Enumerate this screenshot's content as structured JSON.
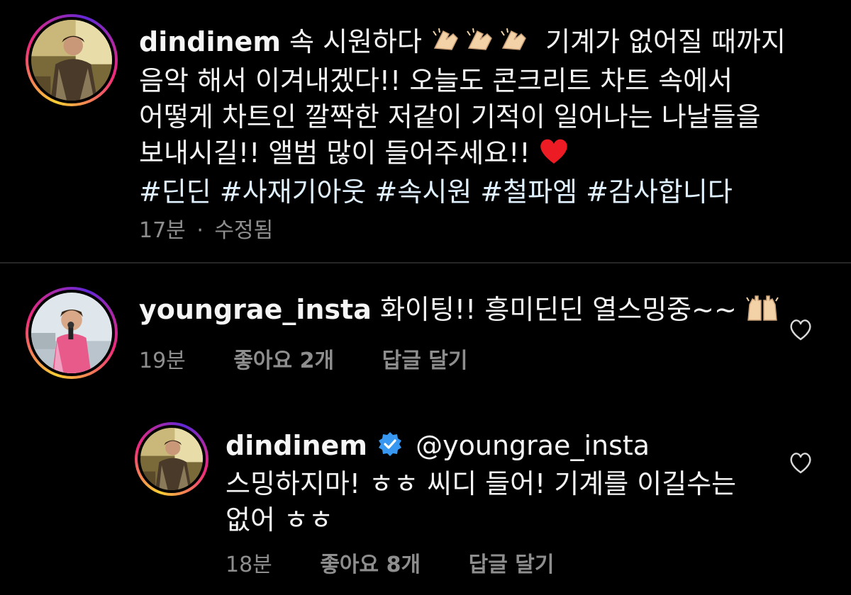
{
  "caption": {
    "username": "dindinem",
    "line1_pre": "속 시원하다",
    "line1_post": "기계가 없어질 때까지",
    "line2": "음악 해서 이겨내겠다!! 오늘도 콘크리트 차트 속에서",
    "line3": "어떻게 차트인 깔짝한 저같이 기적이 일어나는 나날들을",
    "line4": "보내시길!! 앨범 많이 들어주세요!!",
    "hashtags": "#딘딘 #사재기아웃 #속시원 #철파엠 #감사합니다",
    "time": "17분",
    "separator": "·",
    "edited": "수정됨",
    "emoji_clap": "clapping-hands-emoji",
    "emoji_heart": "red-heart-emoji"
  },
  "comment1": {
    "username": "youngrae_insta",
    "text": "화이팅!! 흥미딘딘 열스밍중~~",
    "emoji": "raising-hands-emoji",
    "time": "19분",
    "likes": "좋아요 2개",
    "reply": "답글 달기"
  },
  "reply1": {
    "username": "dindinem",
    "verified_icon": "verified-badge-icon",
    "mention": "@youngrae_insta",
    "line1": "스밍하지마! ㅎㅎ 씨디 들어! 기계를 이길수는",
    "line2": "없어 ㅎㅎ",
    "time": "18분",
    "likes": "좋아요 8개",
    "reply": "답글 달기"
  },
  "colors": {
    "background": "#000000",
    "text": "#f5f5f5",
    "meta": "#8e8e8e",
    "hashtag": "#e0f1ff",
    "verified": "#3897f0",
    "heart": "#ed1c24"
  }
}
